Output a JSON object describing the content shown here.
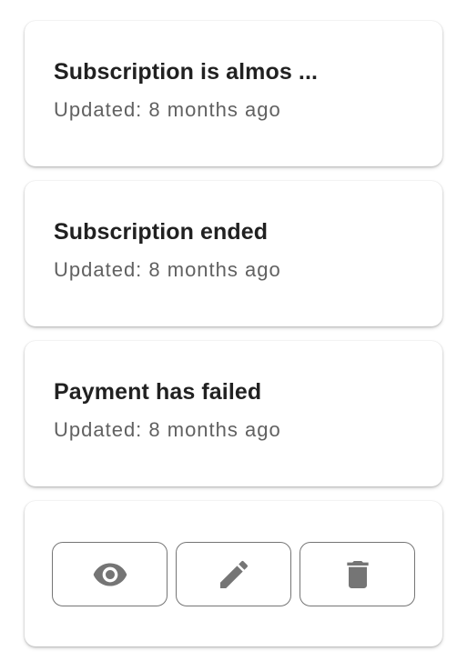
{
  "notifications": [
    {
      "title": "Subscription is almos ...",
      "updated": "Updated: 8 months ago"
    },
    {
      "title": "Subscription ended",
      "updated": "Updated: 8 months ago"
    },
    {
      "title": "Payment has failed",
      "updated": "Updated: 8 months ago"
    }
  ],
  "actions": {
    "view_icon": "eye-icon",
    "edit_icon": "pencil-icon",
    "delete_icon": "trash-icon"
  },
  "colors": {
    "title": "#212121",
    "subtitle": "#616161",
    "icon": "#757575",
    "button_border": "#757575",
    "card_background": "#ffffff"
  }
}
